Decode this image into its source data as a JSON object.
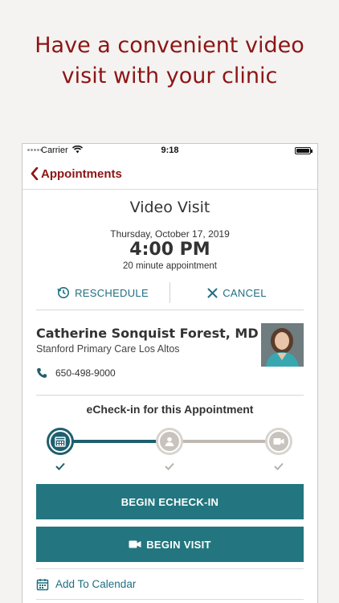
{
  "headline": {
    "line1": "Have a convenient video",
    "line2": "visit with your clinic"
  },
  "status_bar": {
    "carrier": "Carrier",
    "time": "9:18"
  },
  "nav": {
    "back_label": "Appointments"
  },
  "appointment": {
    "title": "Video Visit",
    "date": "Thursday, October 17, 2019",
    "time": "4:00 PM",
    "duration": "20 minute appointment",
    "reschedule_label": "RESCHEDULE",
    "cancel_label": "CANCEL"
  },
  "provider": {
    "name": "Catherine Sonquist Forest, MD",
    "clinic": "Stanford Primary Care Los Altos",
    "phone": "650-498-9000"
  },
  "echeckin": {
    "title": "eCheck-in for this Appointment",
    "steps": [
      {
        "icon": "calendar-icon",
        "state": "active"
      },
      {
        "icon": "person-icon",
        "state": "todo"
      },
      {
        "icon": "video-icon",
        "state": "todo"
      }
    ]
  },
  "buttons": {
    "begin_echeckin": "BEGIN ECHECK-IN",
    "begin_visit": "BEGIN VISIT"
  },
  "links": {
    "add_to_calendar": "Add To Calendar"
  },
  "colors": {
    "brand_red": "#8c1515",
    "teal": "#23767f",
    "teal_dark": "#1f5f6e"
  }
}
